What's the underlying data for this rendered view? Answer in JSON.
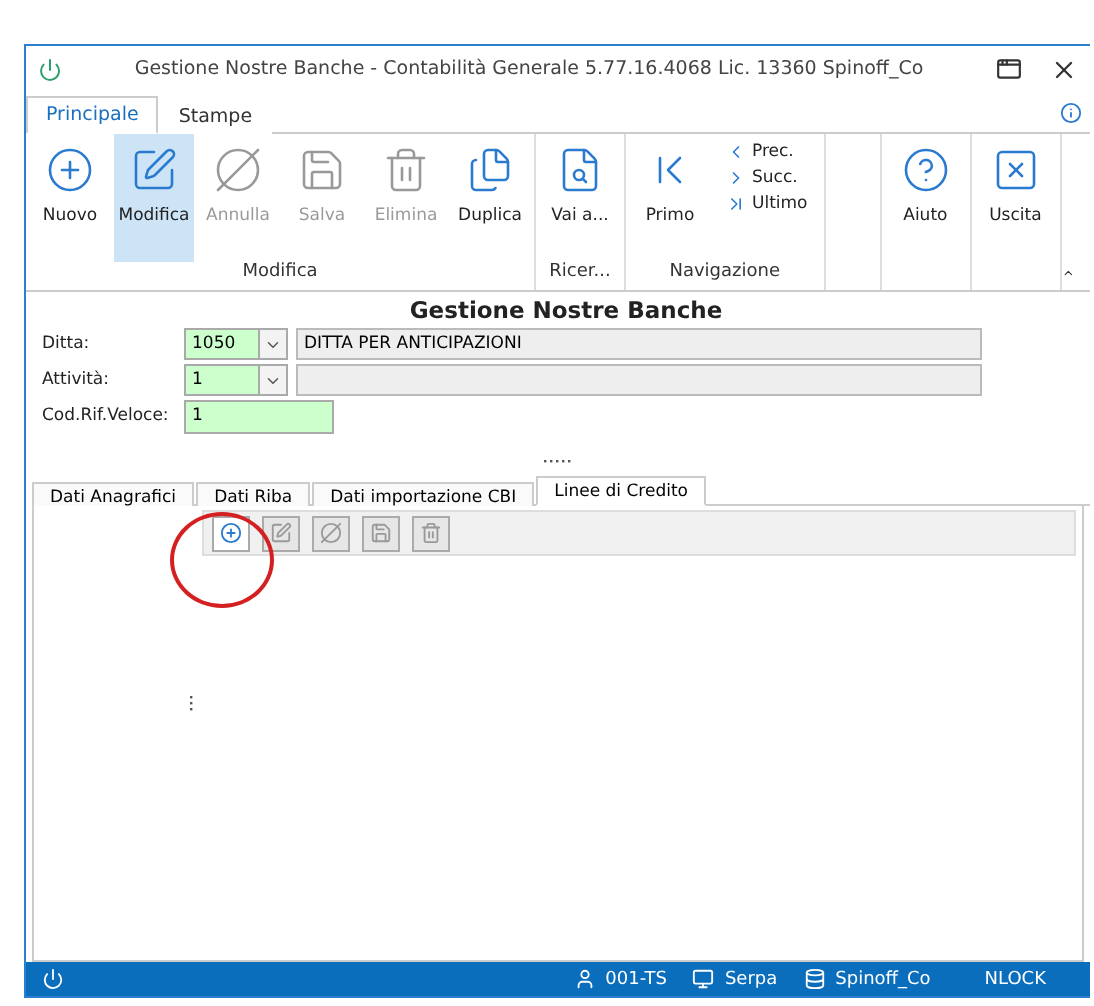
{
  "window": {
    "title": "Gestione Nostre Banche - Contabilità Generale 5.77.16.4068 Lic. 13360 Spinoff_Co"
  },
  "ribbon_tabs": [
    {
      "label": "Principale",
      "selected": true
    },
    {
      "label": "Stampe",
      "selected": false
    }
  ],
  "ribbon_groups": [
    {
      "label": "Modifica",
      "buttons": [
        {
          "label": "Nuovo",
          "selected": false,
          "disabled": false
        },
        {
          "label": "Modifica",
          "selected": true,
          "disabled": false
        },
        {
          "label": "Annulla",
          "selected": false,
          "disabled": true
        },
        {
          "label": "Salva",
          "selected": false,
          "disabled": true
        },
        {
          "label": "Elimina",
          "selected": false,
          "disabled": true
        },
        {
          "label": "Duplica",
          "selected": false,
          "disabled": false
        }
      ]
    },
    {
      "label": "Ricer...",
      "buttons": [
        {
          "label": "Vai a...",
          "selected": false,
          "disabled": false
        }
      ]
    },
    {
      "label": "Navigazione",
      "buttons": [
        {
          "label": "Primo",
          "selected": false,
          "disabled": false
        }
      ],
      "small_buttons": [
        "Prec.",
        "Succ.",
        "Ultimo"
      ]
    },
    {
      "kind": "empty"
    },
    {
      "buttons": [
        {
          "label": "Aiuto",
          "selected": false,
          "disabled": false
        }
      ]
    },
    {
      "buttons": [
        {
          "label": "Uscita",
          "selected": false,
          "disabled": false
        }
      ]
    }
  ],
  "form": {
    "title": "Gestione Nostre Banche",
    "fields": [
      {
        "label": "Ditta:",
        "kind": "combo",
        "value": "1050",
        "description": "DITTA PER ANTICIPAZIONI"
      },
      {
        "label": "Attività:",
        "kind": "combo",
        "value": "1"
      },
      {
        "label": "Cod.Rif.Veloce:",
        "kind": "text",
        "value": "1"
      }
    ]
  },
  "tabs": [
    {
      "label": "Dati Anagrafici",
      "selected": false
    },
    {
      "label": "Dati Riba",
      "selected": false
    },
    {
      "label": "Dati importazione CBI",
      "selected": false
    },
    {
      "label": "Linee di Credito",
      "selected": true
    }
  ],
  "tab_toolbar": [
    {
      "disabled": false
    },
    {
      "disabled": true
    },
    {
      "disabled": true
    },
    {
      "disabled": true
    },
    {
      "disabled": true
    }
  ],
  "status_bar": {
    "user": "001-TS",
    "computer": "Serpa",
    "database": "Spinoff_Co",
    "lock": "NLOCK"
  }
}
